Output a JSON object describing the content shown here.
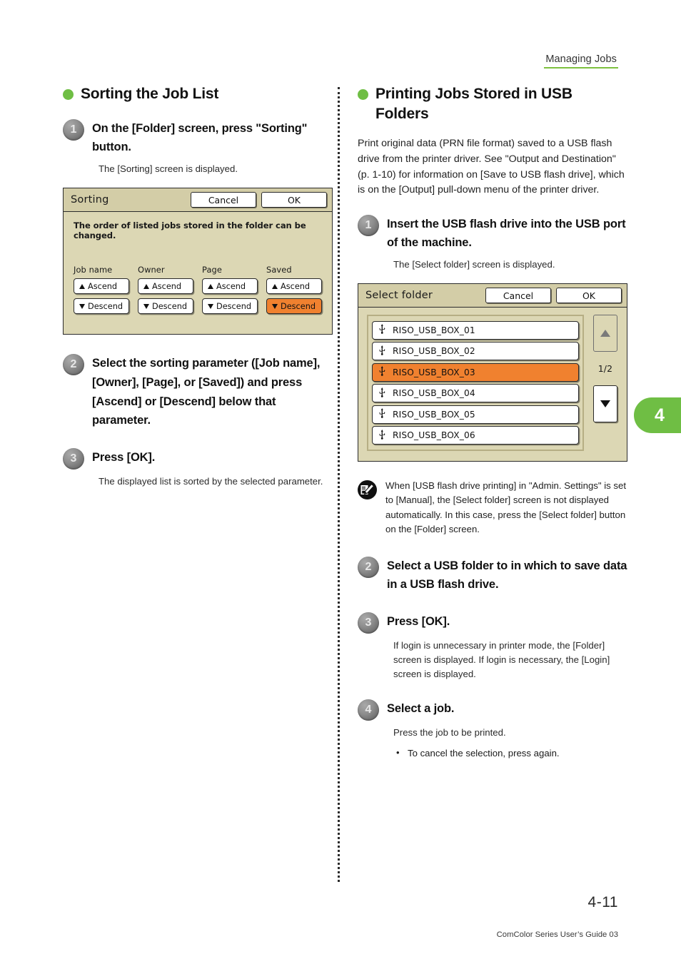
{
  "header": {
    "running_head": "Managing Jobs"
  },
  "chapter_tab": {
    "number": "4"
  },
  "left_column": {
    "heading": "Sorting the Job List",
    "steps": [
      {
        "num": "1",
        "title": "On the [Folder] screen, press \"Sorting\" button.",
        "body": "The [Sorting] screen is displayed."
      },
      {
        "num": "2",
        "title": "Select the sorting parameter ([Job name], [Owner], [Page], or [Saved]) and press [Ascend] or [Descend] below that parameter.",
        "body": ""
      },
      {
        "num": "3",
        "title": "Press [OK].",
        "body": "The displayed list is sorted by the selected parameter."
      }
    ],
    "sorting_panel": {
      "title": "Sorting",
      "cancel_label": "Cancel",
      "ok_label": "OK",
      "description": "The order of listed jobs stored in the folder can be changed.",
      "columns": [
        {
          "label": "Job name",
          "ascend": "Ascend",
          "descend": "Descend",
          "selected": "none"
        },
        {
          "label": "Owner",
          "ascend": "Ascend",
          "descend": "Descend",
          "selected": "none"
        },
        {
          "label": "Page",
          "ascend": "Ascend",
          "descend": "Descend",
          "selected": "none"
        },
        {
          "label": "Saved",
          "ascend": "Ascend",
          "descend": "Descend",
          "selected": "descend"
        }
      ]
    }
  },
  "right_column": {
    "heading": "Printing Jobs Stored in USB Folders",
    "intro": "Print original data (PRN file format) saved to a USB flash drive from the printer driver. See \"Output and Destination\" (p. 1-10) for information on [Save to USB flash drive], which is on the [Output] pull-down menu of the printer driver.",
    "steps": [
      {
        "num": "1",
        "title": "Insert the USB flash drive into the USB port of the machine.",
        "body": "The [Select folder] screen is displayed."
      },
      {
        "num": "2",
        "title": "Select a USB folder to in which to save data in a USB flash drive.",
        "body": ""
      },
      {
        "num": "3",
        "title": "Press [OK].",
        "body": "If login is unnecessary in printer mode, the [Folder] screen is displayed. If login is necessary, the [Login] screen is displayed."
      },
      {
        "num": "4",
        "title": "Select a job.",
        "body": "Press the job to be printed.",
        "bullets": [
          "To cancel the selection, press again."
        ]
      }
    ],
    "note": "When [USB flash drive printing] in \"Admin. Settings\" is set to [Manual], the [Select folder] screen is not displayed automatically. In this case, press the [Select folder] button on the [Folder] screen.",
    "folder_panel": {
      "title": "Select folder",
      "cancel_label": "Cancel",
      "ok_label": "OK",
      "page_indicator": "1/2",
      "items": [
        {
          "label": "RISO_USB_BOX_01",
          "selected": false
        },
        {
          "label": "RISO_USB_BOX_02",
          "selected": false
        },
        {
          "label": "RISO_USB_BOX_03",
          "selected": true
        },
        {
          "label": "RISO_USB_BOX_04",
          "selected": false
        },
        {
          "label": "RISO_USB_BOX_05",
          "selected": false
        },
        {
          "label": "RISO_USB_BOX_06",
          "selected": false
        }
      ],
      "scroll_up_icon": "triangle-up-icon",
      "scroll_down_icon": "triangle-down-icon"
    }
  },
  "footer": {
    "page_number": "4-11",
    "guide_line": "ComColor Series User’s Guide 03"
  },
  "colors": {
    "accent_green": "#6FBE44",
    "panel_beige": "#DCD7B4",
    "panel_titlebar": "#D3CDA7",
    "selection_orange": "#F0812F",
    "step_circle_gray": "#8d8d8d"
  }
}
